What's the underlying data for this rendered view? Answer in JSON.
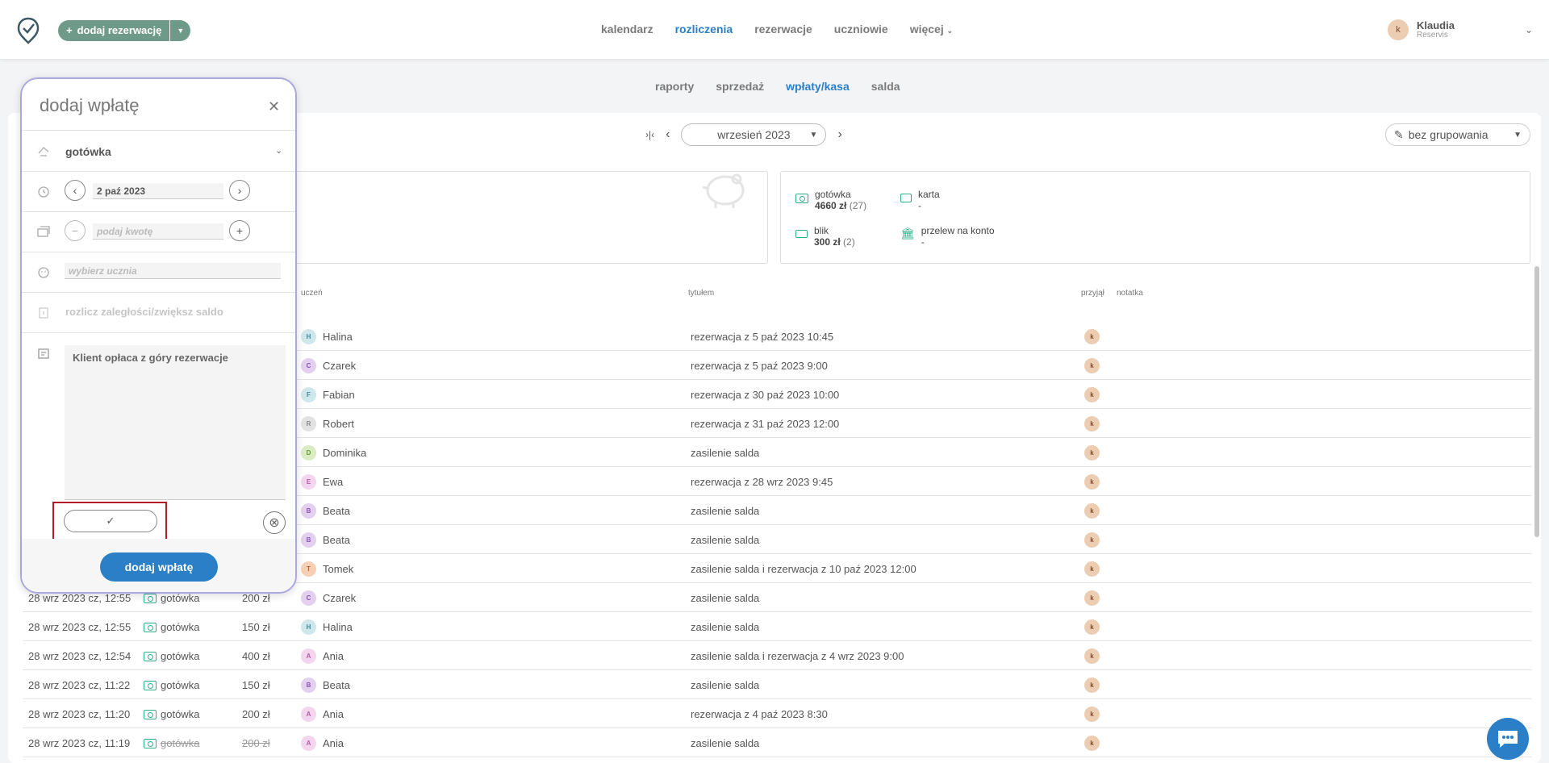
{
  "header": {
    "add_reservation_label": "dodaj rezerwację",
    "nav": [
      "kalendarz",
      "rozliczenia",
      "rezerwacje",
      "uczniowie",
      "więcej"
    ],
    "user": {
      "initial": "k",
      "name": "Klaudia",
      "org": "Reservis"
    }
  },
  "subnav": [
    "raporty",
    "sprzedaż",
    "wpłaty/kasa",
    "salda"
  ],
  "toolbar": {
    "period": "wrzesień 2023",
    "grouping": "bez grupowania"
  },
  "summary": {
    "cash": {
      "label": "gotówka",
      "value": "4660 zł",
      "count": "(27)"
    },
    "card": {
      "label": "karta",
      "value": "-"
    },
    "blik": {
      "label": "blik",
      "value": "300 zł",
      "count": "(2)"
    },
    "transfer": {
      "label": "przelew na konto",
      "value": "-"
    }
  },
  "table": {
    "headers": {
      "student": "uczeń",
      "title": "tytułem",
      "received_by": "przyjął",
      "note": "notatka"
    },
    "rows": [
      {
        "date": "",
        "method": "",
        "amount": "",
        "student_initial": "H",
        "student": "Halina",
        "title": "rezerwacja z 5 paź 2023 10:45",
        "by": "k",
        "color": "#cfe7ea",
        "fg": "#3b8d99"
      },
      {
        "date": "",
        "method": "",
        "amount": "",
        "student_initial": "C",
        "student": "Czarek",
        "title": "rezerwacja z 5 paź 2023 9:00",
        "by": "k",
        "color": "#e3d0ef",
        "fg": "#8a54b0"
      },
      {
        "date": "",
        "method": "",
        "amount": "",
        "student_initial": "F",
        "student": "Fabian",
        "title": "rezerwacja z 30 paź 2023 10:00",
        "by": "k",
        "color": "#cfe7ea",
        "fg": "#3b8d99"
      },
      {
        "date": "",
        "method": "",
        "amount": "",
        "student_initial": "R",
        "student": "Robert",
        "title": "rezerwacja z 31 paź 2023 12:00",
        "by": "k",
        "color": "#e2e2e2",
        "fg": "#888888"
      },
      {
        "date": "",
        "method": "",
        "amount": "",
        "student_initial": "D",
        "student": "Dominika",
        "title": "zasilenie salda",
        "by": "k",
        "color": "#d9ecc4",
        "fg": "#5f9a32"
      },
      {
        "date": "",
        "method": "",
        "amount": "",
        "student_initial": "E",
        "student": "Ewa",
        "title": "rezerwacja z 28 wrz 2023 9:45",
        "by": "k",
        "color": "#f3d6ee",
        "fg": "#b45aa3"
      },
      {
        "date": "",
        "method": "",
        "amount": "",
        "student_initial": "B",
        "student": "Beata",
        "title": "zasilenie salda",
        "by": "k",
        "color": "#e3d0ef",
        "fg": "#8a54b0"
      },
      {
        "date": "",
        "method": "",
        "amount": "",
        "student_initial": "B",
        "student": "Beata",
        "title": "zasilenie salda",
        "by": "k",
        "color": "#e3d0ef",
        "fg": "#8a54b0"
      },
      {
        "date": "",
        "method": "",
        "amount": "",
        "student_initial": "T",
        "student": "Tomek",
        "title": "zasilenie salda i rezerwacja z 10 paź 2023 12:00",
        "by": "k",
        "color": "#f6cfb5",
        "fg": "#c2652c"
      },
      {
        "date": "28 wrz 2023 cz, 12:55",
        "method": "gotówka",
        "amount": "200 zł",
        "student_initial": "C",
        "student": "Czarek",
        "title": "zasilenie salda",
        "by": "k",
        "color": "#e3d0ef",
        "fg": "#8a54b0"
      },
      {
        "date": "28 wrz 2023 cz, 12:55",
        "method": "gotówka",
        "amount": "150 zł",
        "student_initial": "H",
        "student": "Halina",
        "title": "zasilenie salda",
        "by": "k",
        "color": "#cfe7ea",
        "fg": "#3b8d99"
      },
      {
        "date": "28 wrz 2023 cz, 12:54",
        "method": "gotówka",
        "amount": "400 zł",
        "student_initial": "A",
        "student": "Ania",
        "title": "zasilenie salda i rezerwacja z 4 wrz 2023 9:00",
        "by": "k",
        "color": "#f3d6ee",
        "fg": "#b45aa3"
      },
      {
        "date": "28 wrz 2023 cz, 11:22",
        "method": "gotówka",
        "amount": "150 zł",
        "student_initial": "B",
        "student": "Beata",
        "title": "zasilenie salda",
        "by": "k",
        "color": "#e3d0ef",
        "fg": "#8a54b0"
      },
      {
        "date": "28 wrz 2023 cz, 11:20",
        "method": "gotówka",
        "amount": "200 zł",
        "student_initial": "A",
        "student": "Ania",
        "title": "rezerwacja z 4 paź 2023 8:30",
        "by": "k",
        "color": "#f3d6ee",
        "fg": "#b45aa3"
      },
      {
        "date": "28 wrz 2023 cz, 11:19",
        "method": "gotówka",
        "amount": "200 zł",
        "student_initial": "A",
        "student": "Ania",
        "title": "zasilenie salda",
        "by": "k",
        "color": "#f3d6ee",
        "fg": "#b45aa3",
        "cancelled": true
      }
    ]
  },
  "modal": {
    "title": "dodaj wpłatę",
    "payment_method": "gotówka",
    "date": "2 paź 2023",
    "amount_placeholder": "podaj kwotę",
    "student_placeholder": "wybierz ucznia",
    "settle_label": "rozlicz zaległości/zwiększ saldo",
    "note": "Klient opłaca z góry rezerwacje",
    "submit": "dodaj wpłatę"
  },
  "colors": {
    "accent": "#2a7fc7",
    "brand_green": "#6f9a8a",
    "cash_green": "#2fae8a",
    "highlight": "#b21a2a"
  }
}
